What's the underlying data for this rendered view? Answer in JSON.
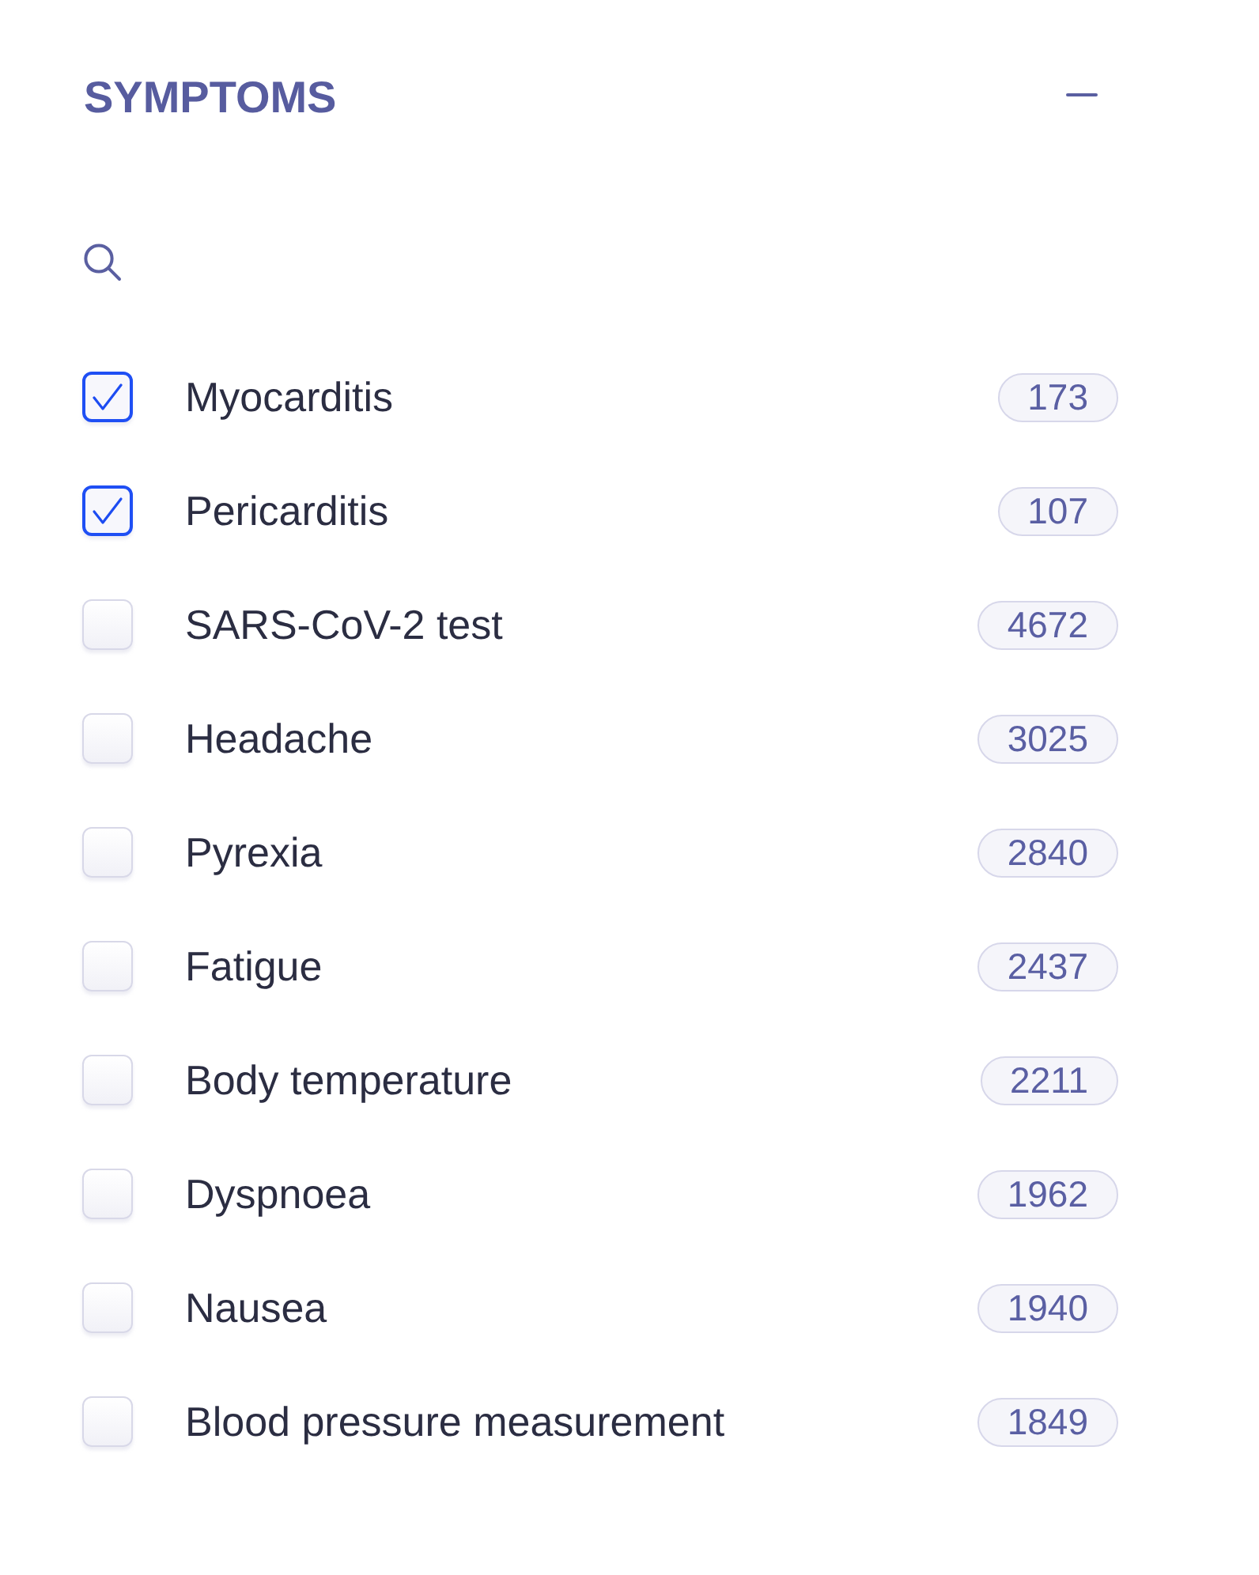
{
  "filter": {
    "title": "SYMPTOMS",
    "expanded": true
  },
  "items": [
    {
      "label": "Myocarditis",
      "count": "173",
      "checked": true
    },
    {
      "label": "Pericarditis",
      "count": "107",
      "checked": true
    },
    {
      "label": "SARS-CoV-2 test",
      "count": "4672",
      "checked": false
    },
    {
      "label": "Headache",
      "count": "3025",
      "checked": false
    },
    {
      "label": "Pyrexia",
      "count": "2840",
      "checked": false
    },
    {
      "label": "Fatigue",
      "count": "2437",
      "checked": false
    },
    {
      "label": "Body temperature",
      "count": "2211",
      "checked": false
    },
    {
      "label": "Dyspnoea",
      "count": "1962",
      "checked": false
    },
    {
      "label": "Nausea",
      "count": "1940",
      "checked": false
    },
    {
      "label": "Blood pressure measurement",
      "count": "1849",
      "checked": false
    }
  ]
}
